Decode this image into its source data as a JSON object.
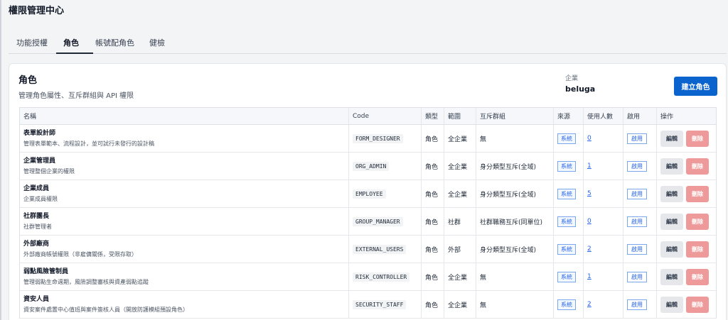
{
  "app_title": "權限管理中心",
  "tabs": [
    {
      "label": "功能授權"
    },
    {
      "label": "角色"
    },
    {
      "label": "帳號配角色"
    },
    {
      "label": "健檢"
    }
  ],
  "active_tab": "角色",
  "card": {
    "title": "角色",
    "subtitle": "管理角色屬性、互斥群組與 API 權限",
    "company_label": "企業",
    "company_value": "beluga",
    "create_button": "建立角色"
  },
  "table": {
    "headers": {
      "name": "名稱",
      "code": "Code",
      "type": "類型",
      "scope": "範圍",
      "exclusion": "互斥群組",
      "source": "來源",
      "users": "使用人數",
      "enabled": "啟用",
      "actions": "操作"
    },
    "edit_label": "編輯",
    "delete_label": "刪除",
    "rows": [
      {
        "name": "表單設計師",
        "desc": "管理表單範本、流程設計，並可試行未發行的設計稿",
        "code": "FORM_DESIGNER",
        "type": "角色",
        "scope": "全企業",
        "exclusion": "無",
        "source": "系統",
        "users": "0",
        "enabled": "啟用"
      },
      {
        "name": "企業管理員",
        "desc": "管理整個企業的權限",
        "code": "ORG_ADMIN",
        "type": "角色",
        "scope": "全企業",
        "exclusion": "身分類型互斥(全域)",
        "source": "系統",
        "users": "1",
        "enabled": "啟用"
      },
      {
        "name": "企業成員",
        "desc": "企業成員權限",
        "code": "EMPLOYEE",
        "type": "角色",
        "scope": "全企業",
        "exclusion": "身分類型互斥(全域)",
        "source": "系統",
        "users": "5",
        "enabled": "啟用"
      },
      {
        "name": "社群團長",
        "desc": "社群管理者",
        "code": "GROUP_MANAGER",
        "type": "角色",
        "scope": "社群",
        "exclusion": "社群職務互斥(同單位)",
        "source": "系統",
        "users": "0",
        "enabled": "啟用"
      },
      {
        "name": "外部廠商",
        "desc": "外部廠商帳號權限（非雇傭關係，受限存取）",
        "code": "EXTERNAL_USERS",
        "type": "角色",
        "scope": "外部",
        "exclusion": "身分類型互斥(全域)",
        "source": "系統",
        "users": "2",
        "enabled": "啟用"
      },
      {
        "name": "弱點風險管制員",
        "desc": "管理弱點生命週期，風險調整審核與資產弱點追蹤",
        "code": "RISK_CONTROLLER",
        "type": "角色",
        "scope": "全企業",
        "exclusion": "無",
        "source": "系統",
        "users": "1",
        "enabled": "啟用"
      },
      {
        "name": "資安人員",
        "desc": "資安案件處置中心值班與案件簽核人員（開放防護模組預設角色）",
        "code": "SECURITY_STAFF",
        "type": "角色",
        "scope": "全企業",
        "exclusion": "無",
        "source": "系統",
        "users": "2",
        "enabled": "啟用"
      }
    ]
  }
}
